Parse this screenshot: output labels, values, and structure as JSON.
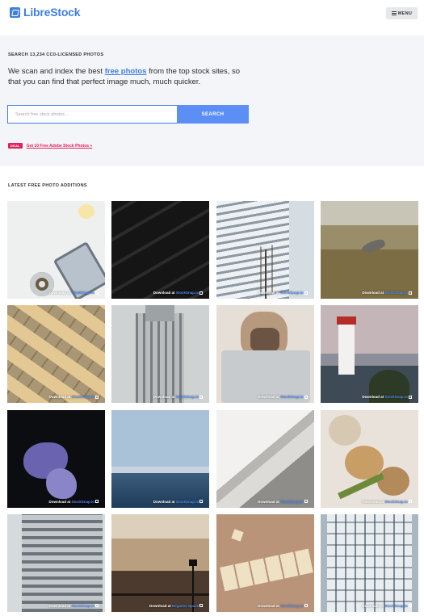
{
  "header": {
    "logo_text": "LibreStock",
    "menu_label": "MENU"
  },
  "hero": {
    "search_label": "SEARCH 13,234 CC0-LICENSED PHOTOS",
    "tagline_before": "We scan and index the best ",
    "tagline_link": "free photos",
    "tagline_after": " from the top stock sites, so that you can find that perfect image much, much quicker.",
    "search_placeholder": "Search free stock photos...",
    "search_button": "SEARCH",
    "deal_badge": "DEAL",
    "deal_text": "Get 10 Free Adobe Stock Photos »"
  },
  "section_title": "LATEST FREE PHOTO ADDITIONS",
  "caption_prefix": "Download at ",
  "photos": [
    {
      "source": "StockSnap.io",
      "scene": "desk-phone-coffee"
    },
    {
      "source": "StockSnap.io",
      "scene": "dark-stripes"
    },
    {
      "source": "StockSnap.io",
      "scene": "glass-building-tree"
    },
    {
      "source": "StockSnap.io",
      "scene": "bird-on-grass"
    },
    {
      "source": "StockSnap.io",
      "scene": "scrabble-positive"
    },
    {
      "source": "StockSnap.io",
      "scene": "art-deco-tower"
    },
    {
      "source": "StockSnap.io",
      "scene": "man-laptop"
    },
    {
      "source": "StockSnap.io",
      "scene": "lighthouse"
    },
    {
      "source": "StockSnap.io",
      "scene": "purple-flower"
    },
    {
      "source": "StockSnap.io",
      "scene": "ocean-horizon"
    },
    {
      "source": "StockSnap.io",
      "scene": "paper-folds"
    },
    {
      "source": "StockSnap.io",
      "scene": "food-plate"
    },
    {
      "source": "StockSnap.io",
      "scene": "office-building"
    },
    {
      "source": "Negative Space",
      "scene": "tripod-clouds"
    },
    {
      "source": "StockSnap.io",
      "scene": "scrabble-stay-home"
    },
    {
      "source": "StockSnap.io",
      "scene": "glass-tower"
    }
  ]
}
